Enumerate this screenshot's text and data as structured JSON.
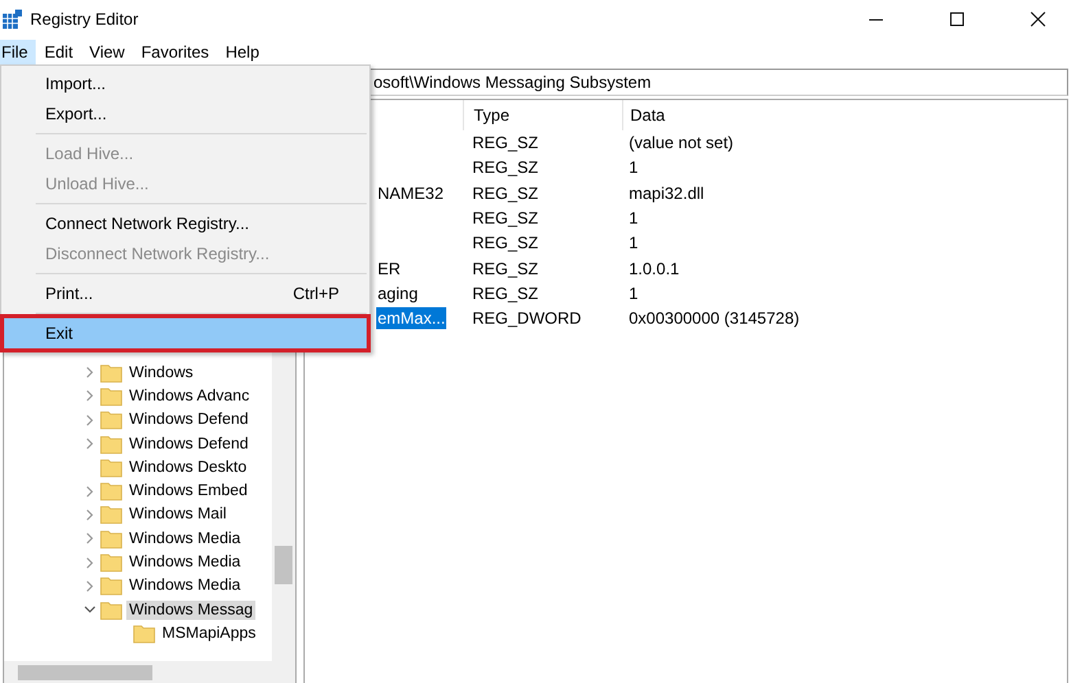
{
  "window": {
    "title": "Registry Editor"
  },
  "menu_bar": [
    {
      "label": "File",
      "selected": true
    },
    {
      "label": "Edit",
      "selected": false
    },
    {
      "label": "View",
      "selected": false
    },
    {
      "label": "Favorites",
      "selected": false
    },
    {
      "label": "Help",
      "selected": false
    }
  ],
  "file_menu": [
    {
      "kind": "item",
      "label": "Import...",
      "disabled": false,
      "highlighted": false,
      "outlined": false
    },
    {
      "kind": "item",
      "label": "Export...",
      "disabled": false,
      "highlighted": false,
      "outlined": false
    },
    {
      "kind": "separator"
    },
    {
      "kind": "item",
      "label": "Load Hive...",
      "disabled": true,
      "highlighted": false,
      "outlined": false
    },
    {
      "kind": "item",
      "label": "Unload Hive...",
      "disabled": true,
      "highlighted": false,
      "outlined": false
    },
    {
      "kind": "separator"
    },
    {
      "kind": "item",
      "label": "Connect Network Registry...",
      "disabled": false,
      "highlighted": false,
      "outlined": false
    },
    {
      "kind": "item",
      "label": "Disconnect Network Registry...",
      "disabled": true,
      "highlighted": false,
      "outlined": false
    },
    {
      "kind": "separator"
    },
    {
      "kind": "item",
      "label": "Print...",
      "shortcut": "Ctrl+P",
      "disabled": false,
      "highlighted": false,
      "outlined": false
    },
    {
      "kind": "separator"
    },
    {
      "kind": "item",
      "label": "Exit",
      "disabled": false,
      "highlighted": true,
      "outlined": true
    }
  ],
  "address_bar": {
    "value": "osoft\\Windows Messaging Subsystem"
  },
  "tree": [
    {
      "label": "Windows",
      "has_subkeys": true,
      "expanded": false,
      "selected": false
    },
    {
      "label": "Windows Advanc",
      "has_subkeys": true,
      "expanded": false,
      "selected": false
    },
    {
      "label": "Windows Defend",
      "has_subkeys": true,
      "expanded": false,
      "selected": false
    },
    {
      "label": "Windows Defend",
      "has_subkeys": true,
      "expanded": false,
      "selected": false
    },
    {
      "label": "Windows Deskto",
      "has_subkeys": false,
      "expanded": false,
      "selected": false
    },
    {
      "label": "Windows Embed",
      "has_subkeys": true,
      "expanded": false,
      "selected": false
    },
    {
      "label": "Windows Mail",
      "has_subkeys": true,
      "expanded": false,
      "selected": false
    },
    {
      "label": "Windows Media",
      "has_subkeys": true,
      "expanded": false,
      "selected": false
    },
    {
      "label": "Windows Media",
      "has_subkeys": true,
      "expanded": false,
      "selected": false
    },
    {
      "label": "Windows Media",
      "has_subkeys": true,
      "expanded": false,
      "selected": false
    },
    {
      "label": "Windows Messag",
      "has_subkeys": true,
      "expanded": true,
      "selected": true,
      "children": [
        {
          "label": "MSMapiApps",
          "has_subkeys": false,
          "expanded": false,
          "selected": false
        }
      ]
    }
  ],
  "values": {
    "columns": [
      "Type",
      "Data"
    ],
    "rows": [
      {
        "type": "REG_SZ",
        "data": "(value not set)",
        "selected": false
      },
      {
        "type": "REG_SZ",
        "data": "1",
        "selected": false
      },
      {
        "name": "NAME32",
        "type": "REG_SZ",
        "data": "mapi32.dll",
        "selected": false
      },
      {
        "type": "REG_SZ",
        "data": "1",
        "selected": false
      },
      {
        "type": "REG_SZ",
        "data": "1",
        "selected": false
      },
      {
        "name": "ER",
        "type": "REG_SZ",
        "data": "1.0.0.1",
        "selected": false
      },
      {
        "name": "aging",
        "type": "REG_SZ",
        "data": "1",
        "selected": false
      },
      {
        "name": "emMax...",
        "type": "REG_DWORD",
        "data": "0x00300000 (3145728)",
        "selected": true
      }
    ]
  }
}
